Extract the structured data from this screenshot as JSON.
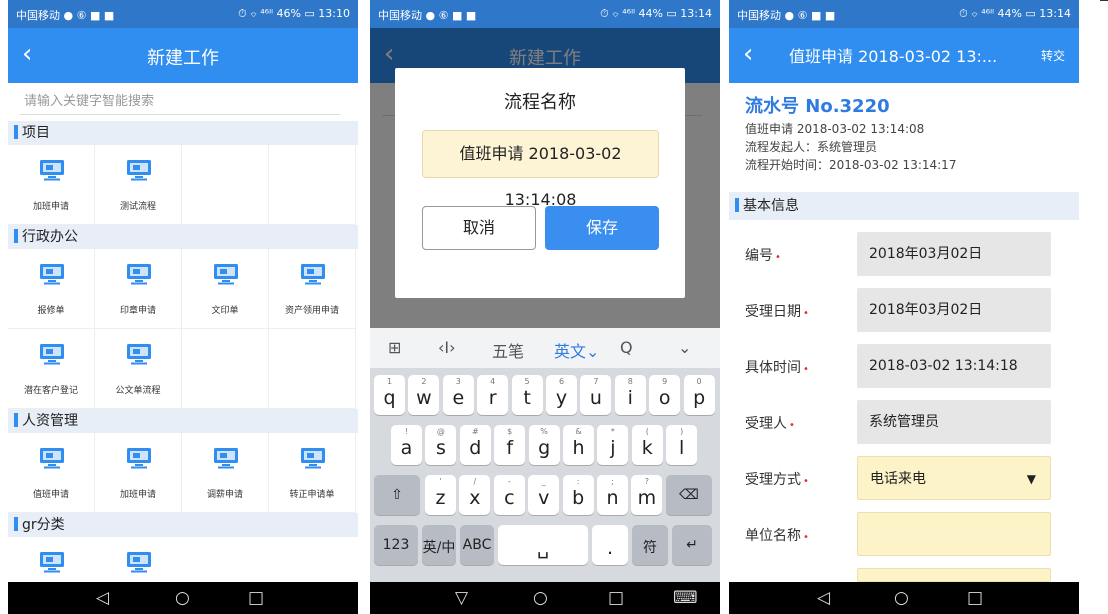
{
  "status_bar": {
    "p1": {
      "left": "中国移动 ● ⑥ ■ ■",
      "right": "⏱ ⌔ ⁴⁶ᴵˡ 46% ▭ 13:10"
    },
    "p2": {
      "left": "中国移动 ● ⑥ ■ ■",
      "right": "⏱ ⌔ ⁴⁶ᴵˡ 44% ▭ 13:14"
    },
    "p3": {
      "left": "中国移动 ● ⑥ ■ ■",
      "right": "⏱ ⌔ ⁴⁶ᴵˡ 44% ▭ 13:14"
    }
  },
  "screen1": {
    "title": "新建工作",
    "back": "‹",
    "search_placeholder": "请输入关键字智能搜索",
    "sections": [
      {
        "name": "项目",
        "items": [
          "加班申请",
          "测试流程"
        ]
      },
      {
        "name": "行政办公",
        "items": [
          "报修单",
          "印章申请",
          "文印单",
          "资产领用申请",
          "潜在客户登记",
          "公文单流程"
        ]
      },
      {
        "name": "人资管理",
        "items": [
          "值班申请",
          "加班申请",
          "调薪申请",
          "转正申请单"
        ]
      },
      {
        "name": "gr分类",
        "items": []
      }
    ]
  },
  "screen2": {
    "bg_title": "新建工作",
    "dialog_title": "流程名称",
    "dialog_value": "值班申请 2018-03-02 13:14:08",
    "cancel": "取消",
    "save": "保存",
    "keyboard": {
      "toolbar": [
        "⊞",
        "‹I›",
        "五笔",
        "英文⌄",
        "Q",
        "⌄"
      ],
      "row1": [
        {
          "k": "q",
          "s": "1"
        },
        {
          "k": "w",
          "s": "2"
        },
        {
          "k": "e",
          "s": "3"
        },
        {
          "k": "r",
          "s": "4"
        },
        {
          "k": "t",
          "s": "5"
        },
        {
          "k": "y",
          "s": "6"
        },
        {
          "k": "u",
          "s": "7"
        },
        {
          "k": "i",
          "s": "8"
        },
        {
          "k": "o",
          "s": "9"
        },
        {
          "k": "p",
          "s": "0"
        }
      ],
      "row2": [
        {
          "k": "a",
          "s": "!"
        },
        {
          "k": "s",
          "s": "@"
        },
        {
          "k": "d",
          "s": "#"
        },
        {
          "k": "f",
          "s": "$"
        },
        {
          "k": "g",
          "s": "%"
        },
        {
          "k": "h",
          "s": "&"
        },
        {
          "k": "j",
          "s": "*"
        },
        {
          "k": "k",
          "s": "("
        },
        {
          "k": "l",
          "s": ")"
        }
      ],
      "row3": [
        {
          "k": "z",
          "s": "'"
        },
        {
          "k": "x",
          "s": "/"
        },
        {
          "k": "c",
          "s": "-"
        },
        {
          "k": "v",
          "s": "_"
        },
        {
          "k": "b",
          "s": ":"
        },
        {
          "k": "n",
          "s": ";"
        },
        {
          "k": "m",
          "s": "?"
        }
      ],
      "shift": "⇧",
      "backspace": "⌫",
      "num": "123",
      "lang": "英/中",
      "abc": "ABC",
      "space": "␣",
      "punct": ".",
      "sym": "符",
      "enter": "↵"
    }
  },
  "screen3": {
    "title": "值班申请 2018-03-02 13:...",
    "action": "转交",
    "flow_no": "流水号 No.3220",
    "info": [
      "值班申请 2018-03-02 13:14:08",
      "流程发起人：系统管理员",
      "流程开始时间：2018-03-02 13:14:17"
    ],
    "section": "基本信息",
    "fields": [
      {
        "label": "编号",
        "value": "2018年03月02日",
        "kind": "ro"
      },
      {
        "label": "受理日期",
        "value": "2018年03月02日",
        "kind": "ro"
      },
      {
        "label": "具体时间",
        "value": "2018-03-02 13:14:18",
        "kind": "ro"
      },
      {
        "label": "受理人",
        "value": "系统管理员",
        "kind": "ro"
      },
      {
        "label": "受理方式",
        "value": "电话来电",
        "kind": "sel"
      },
      {
        "label": "单位名称",
        "value": "",
        "kind": "empty"
      }
    ],
    "req_mark": "•"
  },
  "nav_buttons": {
    "back": "◁",
    "home": "○",
    "recent": "□",
    "hide": "▽",
    "kbd": "⌨"
  },
  "colors": {
    "primary": "#2f8ef0",
    "status": "#2f77c9",
    "section_bg": "#e8eef8",
    "field_yellow": "#fdf3c8"
  }
}
